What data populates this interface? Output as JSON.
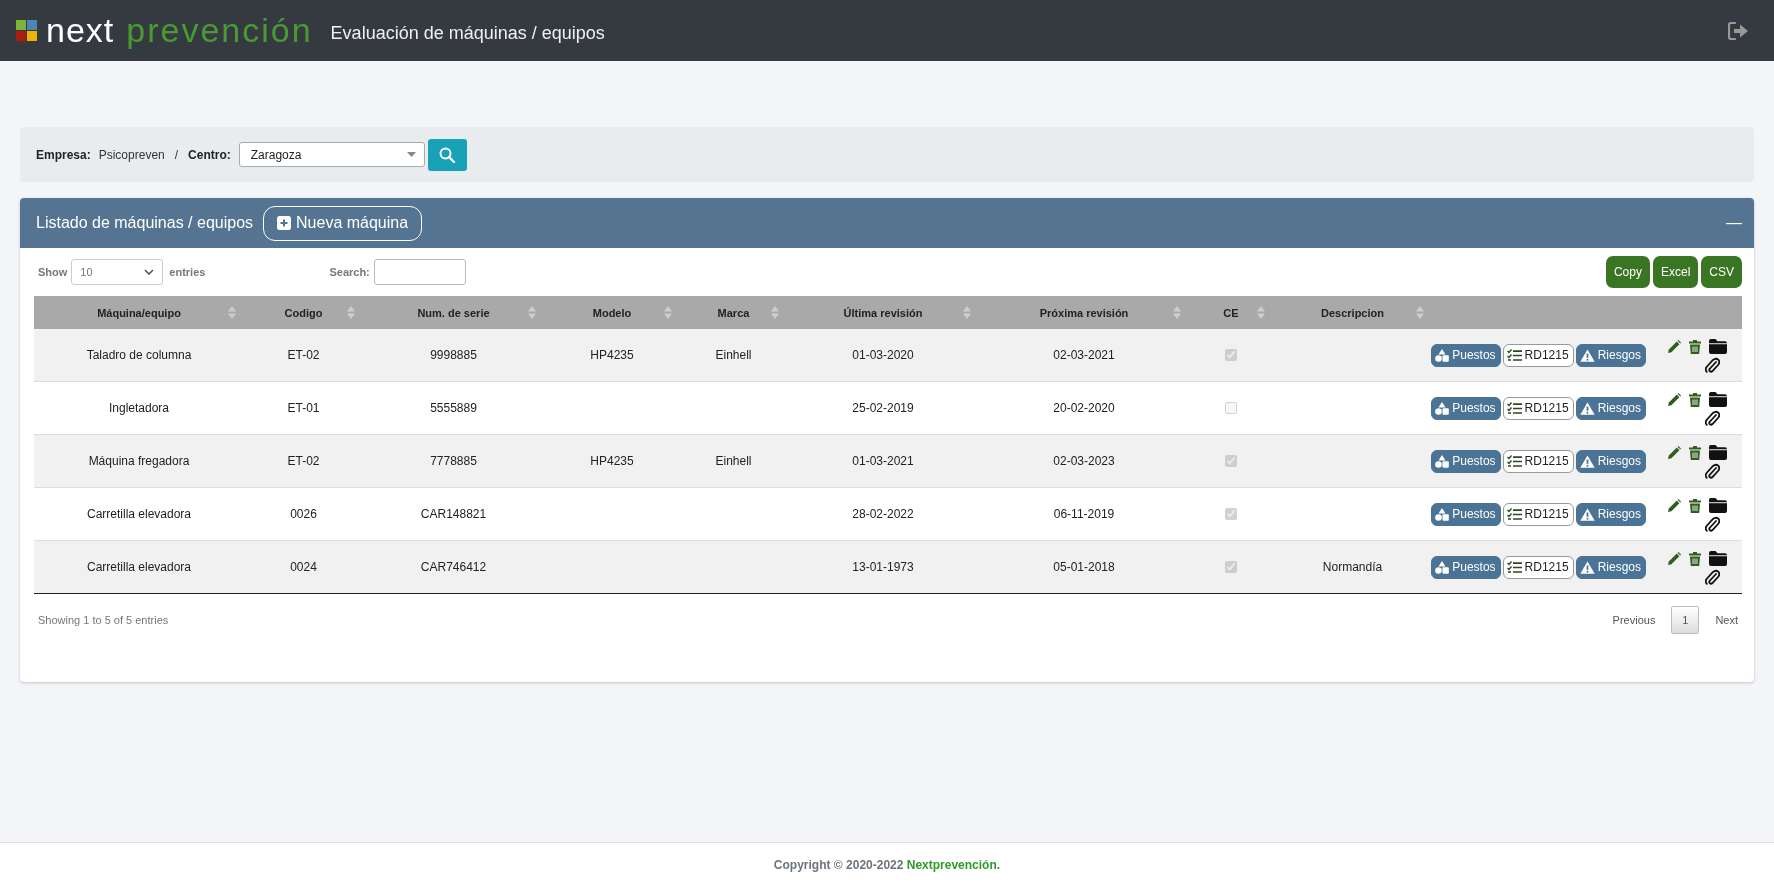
{
  "app": {
    "logo_word1": "next",
    "logo_word2": "prevención",
    "page_title": "Evaluación de máquinas / equipos"
  },
  "filter": {
    "empresa_label": "Empresa:",
    "empresa_value": "Psicopreven",
    "separator": "/",
    "centro_label": "Centro:",
    "centro_value": "Zaragoza"
  },
  "card": {
    "title": "Listado de máquinas / equipos",
    "new_button": "Nueva máquina",
    "collapse": "—"
  },
  "length": {
    "label_before": "Show",
    "value": "10",
    "label_after": "entries"
  },
  "search": {
    "label": "Search:"
  },
  "export_buttons": [
    "Copy",
    "Excel",
    "CSV"
  ],
  "table": {
    "columns": [
      "Máquina/equipo",
      "Codigo",
      "Num. de serie",
      "Modelo",
      "Marca",
      "Última revisión",
      "Próxima revisión",
      "CE",
      "Descripcion"
    ],
    "rows": [
      {
        "cells": [
          "Taladro de columna",
          "ET-02",
          "9998885",
          "HP4235",
          "Einhell",
          "01-03-2020",
          "02-03-2021"
        ],
        "ce_checked": true,
        "actions": [
          "Puestos",
          "RD1215",
          "Riesgos"
        ]
      },
      {
        "cells": [
          "Ingletadora",
          "ET-01",
          "5555889",
          "",
          "",
          "25-02-2019",
          "20-02-2020"
        ],
        "ce_checked": false,
        "actions": [
          "Puestos",
          "RD1215",
          "Riesgos"
        ]
      },
      {
        "cells": [
          "Máquina fregadora",
          "ET-02",
          "7778885",
          "HP4235",
          "Einhell",
          "01-03-2021",
          "02-03-2023"
        ],
        "ce_checked": true,
        "actions": [
          "Puestos",
          "RD1215",
          "Riesgos"
        ]
      },
      {
        "cells": [
          "Carretilla elevadora",
          "0026",
          "CAR148821",
          "",
          "",
          "28-02-2022",
          "06-11-2019"
        ],
        "ce_checked": true,
        "actions": [
          "Puestos",
          "RD1215",
          "Riesgos"
        ]
      },
      {
        "cells": [
          "Carretilla elevadora",
          "0024",
          "CAR746412",
          "",
          "",
          "13-01-1973",
          "05-01-2018"
        ],
        "ce_checked": true,
        "description": "Normandía",
        "actions": [
          "Puestos",
          "RD1215",
          "Riesgos"
        ]
      }
    ]
  },
  "info": "Showing 1 to 5 of 5 entries",
  "pagination": {
    "previous": "Previous",
    "pages": [
      {
        "label": "1",
        "selected": true
      }
    ],
    "next": "Next"
  },
  "footer": {
    "copyright": "Copyright © 2020-2022",
    "brand": "Nextprevención."
  }
}
